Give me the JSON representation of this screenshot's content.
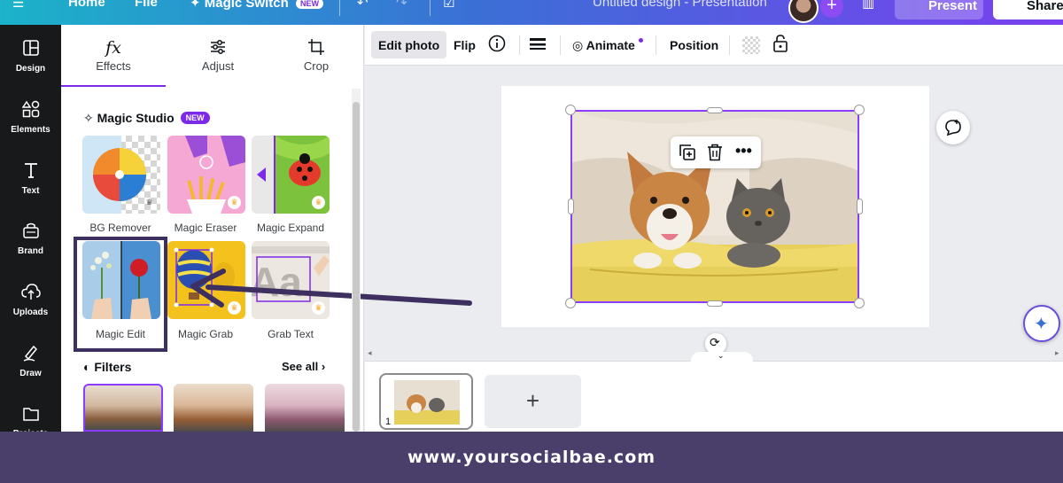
{
  "topbar": {
    "home": "Home",
    "file": "File",
    "magic_switch": "Magic Switch",
    "new_badge": "NEW",
    "doc_title": "Untitled design - Presentation",
    "present": "Present",
    "share": "Share"
  },
  "rail": {
    "items": [
      {
        "label": "Design",
        "icon": "layout-icon"
      },
      {
        "label": "Elements",
        "icon": "shapes-icon"
      },
      {
        "label": "Text",
        "icon": "text-icon"
      },
      {
        "label": "Brand",
        "icon": "brand-icon"
      },
      {
        "label": "Uploads",
        "icon": "cloud-upload-icon"
      },
      {
        "label": "Draw",
        "icon": "draw-icon"
      },
      {
        "label": "Projects",
        "icon": "folder-icon"
      }
    ]
  },
  "panel": {
    "tabs": [
      {
        "label": "Effects",
        "icon": "fx"
      },
      {
        "label": "Adjust",
        "icon": "sliders-icon"
      },
      {
        "label": "Crop",
        "icon": "crop-icon"
      }
    ],
    "magic_studio": "Magic Studio",
    "new_badge": "NEW",
    "tools": [
      {
        "label": "BG Remover"
      },
      {
        "label": "Magic Eraser"
      },
      {
        "label": "Magic Expand"
      },
      {
        "label": "Magic Edit"
      },
      {
        "label": "Magic Grab"
      },
      {
        "label": "Grab Text"
      }
    ],
    "filters": "Filters",
    "see_all": "See all"
  },
  "toolbar": {
    "edit_photo": "Edit photo",
    "flip": "Flip",
    "animate": "Animate",
    "position": "Position"
  },
  "pages": {
    "page_number": "1",
    "add_page": "+"
  },
  "footer": {
    "website": "www.yoursocialbae.com"
  },
  "colors": {
    "accent": "#7d2ae8",
    "selection": "#8b3dff",
    "highlight": "#3d3060",
    "footer_bg": "#4a3f6b"
  }
}
